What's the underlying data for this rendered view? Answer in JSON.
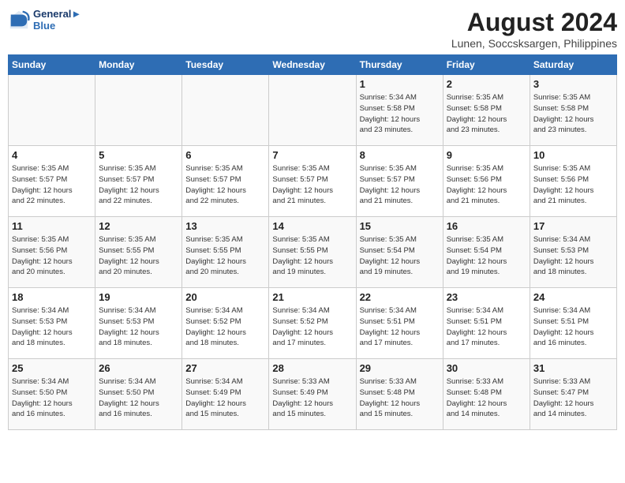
{
  "header": {
    "logo_line1": "General",
    "logo_line2": "Blue",
    "title": "August 2024",
    "subtitle": "Lunen, Soccsksargen, Philippines"
  },
  "weekdays": [
    "Sunday",
    "Monday",
    "Tuesday",
    "Wednesday",
    "Thursday",
    "Friday",
    "Saturday"
  ],
  "weeks": [
    [
      {
        "day": "",
        "info": ""
      },
      {
        "day": "",
        "info": ""
      },
      {
        "day": "",
        "info": ""
      },
      {
        "day": "",
        "info": ""
      },
      {
        "day": "1",
        "info": "Sunrise: 5:34 AM\nSunset: 5:58 PM\nDaylight: 12 hours\nand 23 minutes."
      },
      {
        "day": "2",
        "info": "Sunrise: 5:35 AM\nSunset: 5:58 PM\nDaylight: 12 hours\nand 23 minutes."
      },
      {
        "day": "3",
        "info": "Sunrise: 5:35 AM\nSunset: 5:58 PM\nDaylight: 12 hours\nand 23 minutes."
      }
    ],
    [
      {
        "day": "4",
        "info": "Sunrise: 5:35 AM\nSunset: 5:57 PM\nDaylight: 12 hours\nand 22 minutes."
      },
      {
        "day": "5",
        "info": "Sunrise: 5:35 AM\nSunset: 5:57 PM\nDaylight: 12 hours\nand 22 minutes."
      },
      {
        "day": "6",
        "info": "Sunrise: 5:35 AM\nSunset: 5:57 PM\nDaylight: 12 hours\nand 22 minutes."
      },
      {
        "day": "7",
        "info": "Sunrise: 5:35 AM\nSunset: 5:57 PM\nDaylight: 12 hours\nand 21 minutes."
      },
      {
        "day": "8",
        "info": "Sunrise: 5:35 AM\nSunset: 5:57 PM\nDaylight: 12 hours\nand 21 minutes."
      },
      {
        "day": "9",
        "info": "Sunrise: 5:35 AM\nSunset: 5:56 PM\nDaylight: 12 hours\nand 21 minutes."
      },
      {
        "day": "10",
        "info": "Sunrise: 5:35 AM\nSunset: 5:56 PM\nDaylight: 12 hours\nand 21 minutes."
      }
    ],
    [
      {
        "day": "11",
        "info": "Sunrise: 5:35 AM\nSunset: 5:56 PM\nDaylight: 12 hours\nand 20 minutes."
      },
      {
        "day": "12",
        "info": "Sunrise: 5:35 AM\nSunset: 5:55 PM\nDaylight: 12 hours\nand 20 minutes."
      },
      {
        "day": "13",
        "info": "Sunrise: 5:35 AM\nSunset: 5:55 PM\nDaylight: 12 hours\nand 20 minutes."
      },
      {
        "day": "14",
        "info": "Sunrise: 5:35 AM\nSunset: 5:55 PM\nDaylight: 12 hours\nand 19 minutes."
      },
      {
        "day": "15",
        "info": "Sunrise: 5:35 AM\nSunset: 5:54 PM\nDaylight: 12 hours\nand 19 minutes."
      },
      {
        "day": "16",
        "info": "Sunrise: 5:35 AM\nSunset: 5:54 PM\nDaylight: 12 hours\nand 19 minutes."
      },
      {
        "day": "17",
        "info": "Sunrise: 5:34 AM\nSunset: 5:53 PM\nDaylight: 12 hours\nand 18 minutes."
      }
    ],
    [
      {
        "day": "18",
        "info": "Sunrise: 5:34 AM\nSunset: 5:53 PM\nDaylight: 12 hours\nand 18 minutes."
      },
      {
        "day": "19",
        "info": "Sunrise: 5:34 AM\nSunset: 5:53 PM\nDaylight: 12 hours\nand 18 minutes."
      },
      {
        "day": "20",
        "info": "Sunrise: 5:34 AM\nSunset: 5:52 PM\nDaylight: 12 hours\nand 18 minutes."
      },
      {
        "day": "21",
        "info": "Sunrise: 5:34 AM\nSunset: 5:52 PM\nDaylight: 12 hours\nand 17 minutes."
      },
      {
        "day": "22",
        "info": "Sunrise: 5:34 AM\nSunset: 5:51 PM\nDaylight: 12 hours\nand 17 minutes."
      },
      {
        "day": "23",
        "info": "Sunrise: 5:34 AM\nSunset: 5:51 PM\nDaylight: 12 hours\nand 17 minutes."
      },
      {
        "day": "24",
        "info": "Sunrise: 5:34 AM\nSunset: 5:51 PM\nDaylight: 12 hours\nand 16 minutes."
      }
    ],
    [
      {
        "day": "25",
        "info": "Sunrise: 5:34 AM\nSunset: 5:50 PM\nDaylight: 12 hours\nand 16 minutes."
      },
      {
        "day": "26",
        "info": "Sunrise: 5:34 AM\nSunset: 5:50 PM\nDaylight: 12 hours\nand 16 minutes."
      },
      {
        "day": "27",
        "info": "Sunrise: 5:34 AM\nSunset: 5:49 PM\nDaylight: 12 hours\nand 15 minutes."
      },
      {
        "day": "28",
        "info": "Sunrise: 5:33 AM\nSunset: 5:49 PM\nDaylight: 12 hours\nand 15 minutes."
      },
      {
        "day": "29",
        "info": "Sunrise: 5:33 AM\nSunset: 5:48 PM\nDaylight: 12 hours\nand 15 minutes."
      },
      {
        "day": "30",
        "info": "Sunrise: 5:33 AM\nSunset: 5:48 PM\nDaylight: 12 hours\nand 14 minutes."
      },
      {
        "day": "31",
        "info": "Sunrise: 5:33 AM\nSunset: 5:47 PM\nDaylight: 12 hours\nand 14 minutes."
      }
    ]
  ]
}
